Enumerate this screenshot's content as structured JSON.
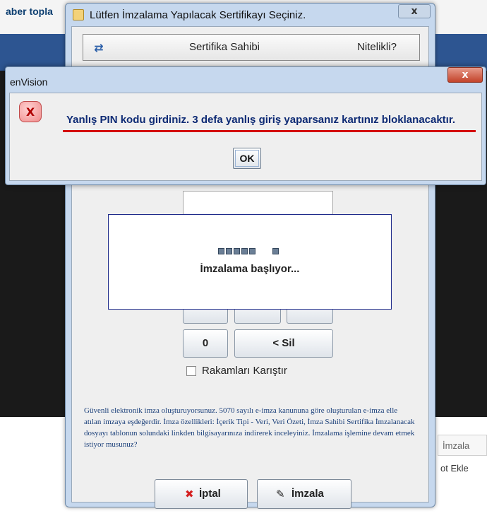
{
  "background": {
    "page_title": "aber topla",
    "column_header": "İmzala",
    "row_text": "ot Ekle"
  },
  "main_dialog": {
    "title": "Lütfen İmzalama Yapılacak Sertifikayı Seçiniz.",
    "close_label": "x",
    "table": {
      "refresh_icon": "refresh-icon",
      "columns": [
        "Sertifika Sahibi",
        "Nitelikli?"
      ]
    },
    "keypad": [
      "",
      "",
      "",
      "0",
      "< Sil"
    ],
    "shuffle_label": "Rakamları Karıştır",
    "info_text": "Güvenli elektronik imza oluşturuyorsunuz. 5070 sayılı e-imza kanununa göre oluşturulan e-imza elle atılan imzaya eşdeğerdir. İmza özellikleri: İçerik Tipi - Veri, Veri Özeti, İmza Sahibi Sertifika İmzalanacak dosyayı tablonun solundaki linkden bilgisayarınıza indirerek inceleyiniz.  İmzalama işlemine devam etmek istiyor musunuz?",
    "cancel_label": "İptal",
    "sign_label": "İmzala",
    "colors": {
      "cancel_icon": "#d42020",
      "accent": "#2d5591"
    }
  },
  "progress": {
    "text": "İmzalama başlıyor..."
  },
  "error_dialog": {
    "title": "enVision",
    "close_label": "x",
    "icon": "error-icon",
    "icon_glyph": "X",
    "message": "Yanlış PIN kodu girdiniz. 3 defa yanlış giriş yaparsanız kartınız bloklanacaktır.",
    "ok_label": "OK",
    "colors": {
      "message": "#0d2a74",
      "underline": "#d40000"
    }
  }
}
